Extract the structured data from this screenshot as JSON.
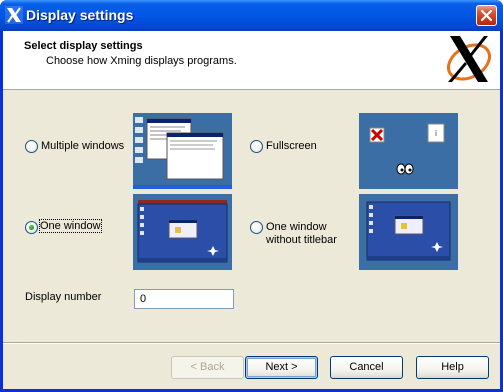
{
  "window": {
    "title": "Display settings"
  },
  "header": {
    "title": "Select display settings",
    "subtitle": "Choose how Xming displays programs."
  },
  "options": {
    "multiple_windows": {
      "label": "Multiple windows",
      "checked": false
    },
    "fullscreen": {
      "label": "Fullscreen",
      "checked": false
    },
    "one_window": {
      "label": "One window",
      "checked": true
    },
    "one_window_no_titlebar": {
      "label_line1": "One window",
      "label_line2": "without titlebar",
      "checked": false
    }
  },
  "display_number": {
    "label": "Display number",
    "value": "0"
  },
  "buttons": {
    "back": {
      "label": "< Back",
      "enabled": false
    },
    "next": {
      "label": "Next >",
      "default": true
    },
    "cancel": {
      "label": "Cancel"
    },
    "help": {
      "label": "Help"
    }
  },
  "colors": {
    "titlebar": "#0054e3",
    "dialog_bg": "#ece9d8",
    "desktop_blue": "#3a6ea5",
    "logo_orange": "#e8721c"
  }
}
